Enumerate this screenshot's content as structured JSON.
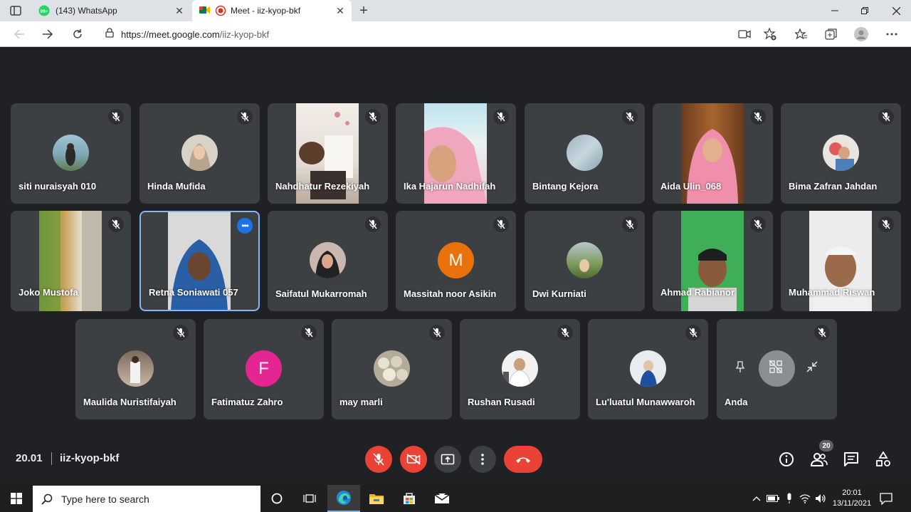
{
  "browser": {
    "tabs": [
      {
        "label": "(143) WhatsApp",
        "badge": "99+",
        "active": false
      },
      {
        "label": "Meet - iiz-kyop-bkf",
        "active": true
      }
    ],
    "url_host": "https://meet.google.com",
    "url_path": "/iiz-kyop-bkf"
  },
  "participants": [
    {
      "name": "siti nuraisyah 010",
      "kind": "avatar"
    },
    {
      "name": "Hinda Mufida",
      "kind": "avatar"
    },
    {
      "name": "Nahdhatur Rezekiyah",
      "kind": "video"
    },
    {
      "name": "Ika Hajarun Nadhifah",
      "kind": "video"
    },
    {
      "name": "Bintang Kejora",
      "kind": "avatar"
    },
    {
      "name": "Aida Ulin_068",
      "kind": "video"
    },
    {
      "name": "Bima Zafran Jahdan",
      "kind": "avatar"
    },
    {
      "name": "Joko Mustofa",
      "kind": "video"
    },
    {
      "name": "Retna Soniawati 057",
      "kind": "video",
      "active": true
    },
    {
      "name": "Saifatul Mukarromah",
      "kind": "avatar"
    },
    {
      "name": "Massitah noor Asikin",
      "kind": "letter",
      "letter": "M",
      "color": "#e8710a"
    },
    {
      "name": "Dwi Kurniati",
      "kind": "avatar"
    },
    {
      "name": "Ahmad Rabianor",
      "kind": "video"
    },
    {
      "name": "Muhammad Riswan",
      "kind": "video"
    },
    {
      "name": "Maulida Nuristifaiyah",
      "kind": "avatar"
    },
    {
      "name": "Fatimatuz Zahro",
      "kind": "letter",
      "letter": "F",
      "color": "#e52592"
    },
    {
      "name": "may marli",
      "kind": "avatar"
    },
    {
      "name": "Rushan Rusadi",
      "kind": "avatar"
    },
    {
      "name": "Lu'luatul Munawwaroh",
      "kind": "avatar"
    },
    {
      "name": "Anda",
      "kind": "self"
    }
  ],
  "meeting": {
    "time": "20.01",
    "code": "iiz-kyop-bkf",
    "participant_count": "20"
  },
  "taskbar": {
    "search_placeholder": "Type here to search",
    "time": "20:01",
    "date": "13/11/2021"
  },
  "colors": {
    "red": "#ea4335",
    "accent_blue": "#8ab4f8",
    "tile": "#3c4043",
    "background": "#202124"
  }
}
